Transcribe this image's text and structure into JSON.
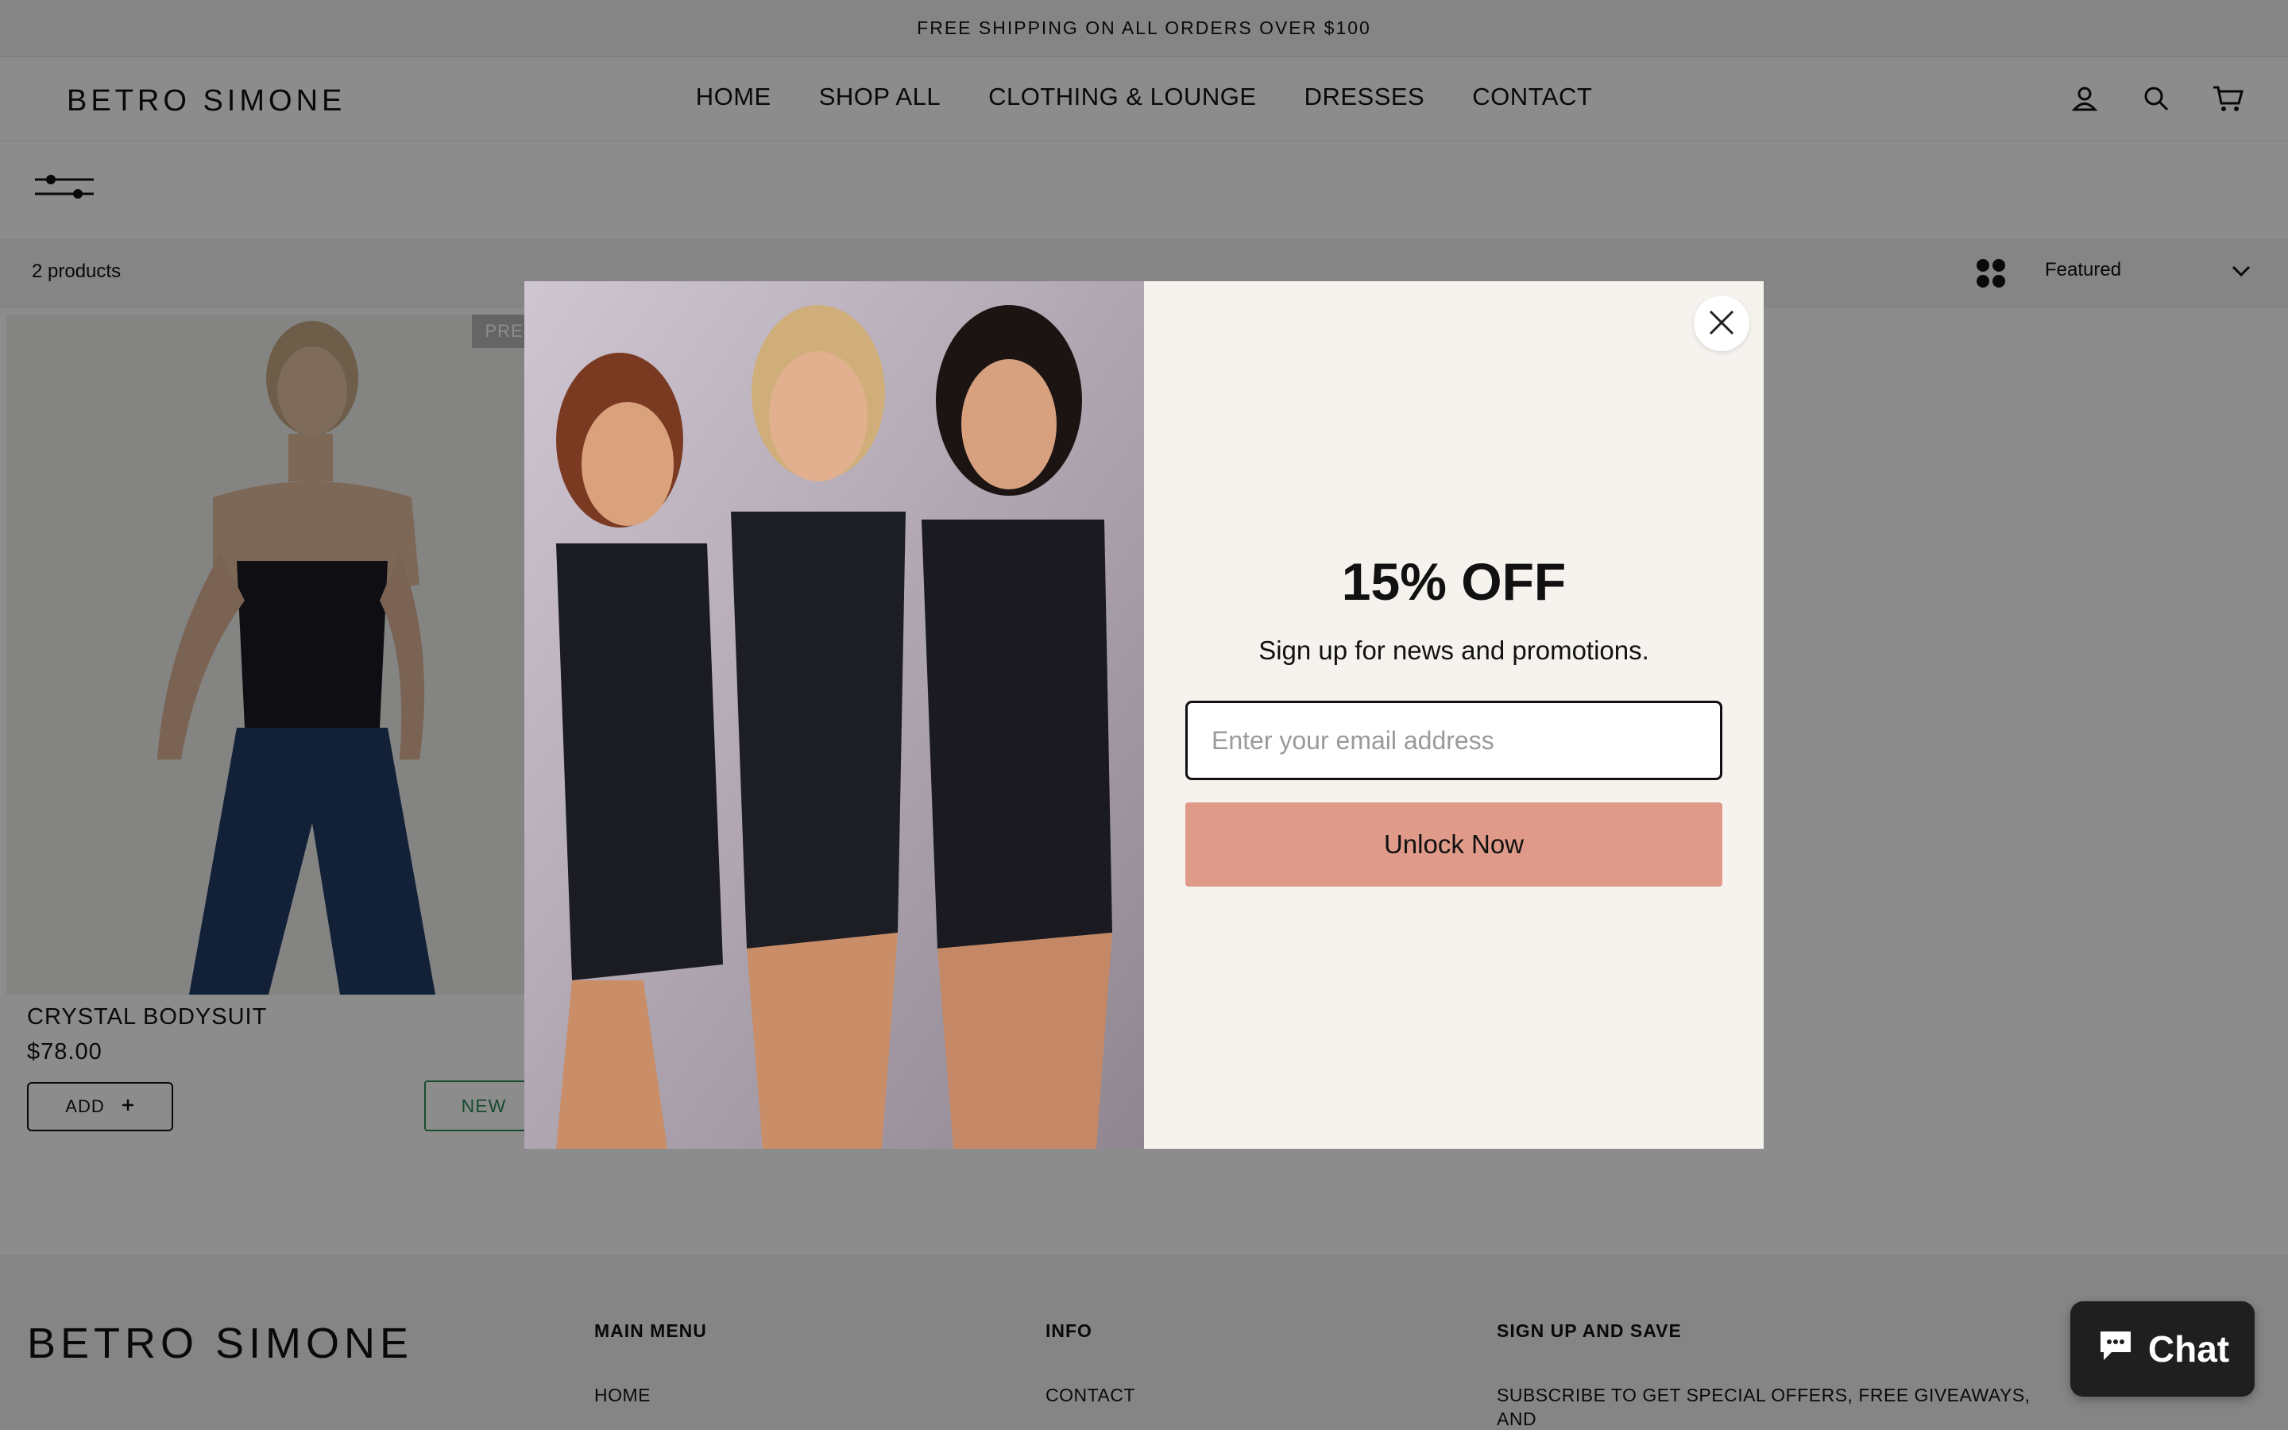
{
  "announcement": "FREE SHIPPING ON ALL ORDERS OVER $100",
  "header": {
    "logo": "BETRO SIMONE",
    "nav": [
      "HOME",
      "SHOP ALL",
      "CLOTHING & LOUNGE",
      "DRESSES",
      "CONTACT"
    ],
    "icons": [
      "account-icon",
      "search-icon",
      "cart-icon"
    ]
  },
  "toolbar": {
    "product_count": "2 products",
    "sort_selected": "Featured"
  },
  "products": [
    {
      "name": "CRYSTAL BODYSUIT",
      "price": "$78.00",
      "add_label": "ADD",
      "badge": "NEW",
      "pre_badge": "PRE-OR"
    }
  ],
  "footer": {
    "logo": "BETRO SIMONE",
    "main_menu": {
      "title": "MAIN MENU",
      "items": [
        "HOME"
      ]
    },
    "info": {
      "title": "INFO",
      "items": [
        "CONTACT"
      ]
    },
    "signup": {
      "title": "SIGN UP AND SAVE",
      "text": "SUBSCRIBE TO GET SPECIAL OFFERS, FREE GIVEAWAYS, AND"
    }
  },
  "modal": {
    "title": "15% OFF",
    "subtitle": "Sign up for news and promotions.",
    "email_placeholder": "Enter your email address",
    "button": "Unlock Now"
  },
  "chat": {
    "label": "Chat"
  },
  "colors": {
    "accent_button": "#e09a89",
    "new_badge": "#2e8b57",
    "modal_bg": "#f6f3ef",
    "chat_bg": "#1f1f1f"
  }
}
